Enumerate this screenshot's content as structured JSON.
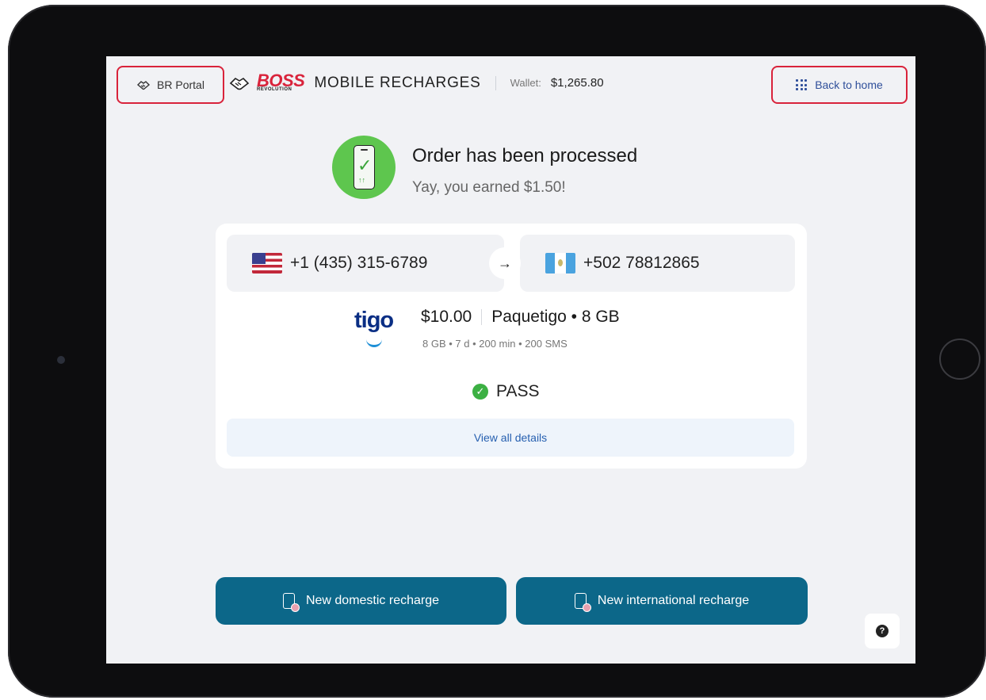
{
  "header": {
    "portal_label": "BR Portal",
    "brand_name": "BOSS",
    "brand_sub": "REVOLUTION",
    "app_title": "MOBILE RECHARGES",
    "wallet_label": "Wallet:",
    "wallet_value": "$1,265.80",
    "back_label": "Back to home",
    "accent_color": "#d9233b"
  },
  "order": {
    "title": "Order has been processed",
    "subtitle": "Yay, you earned $1.50!"
  },
  "recharge": {
    "from_number": "+1 (435) 315-6789",
    "from_flag": "us-flag-icon",
    "to_number": "+502 78812865",
    "to_flag": "guatemala-flag-icon",
    "carrier": "tigo",
    "amount": "$10.00",
    "plan_name": "Paquetigo • 8 GB",
    "plan_details": "8 GB • 7 d • 200 min • 200 SMS",
    "status": "PASS",
    "view_details": "View all details"
  },
  "actions": {
    "domestic": "New domestic recharge",
    "international": "New international recharge",
    "help": "?",
    "primary_color": "#0c6789"
  }
}
